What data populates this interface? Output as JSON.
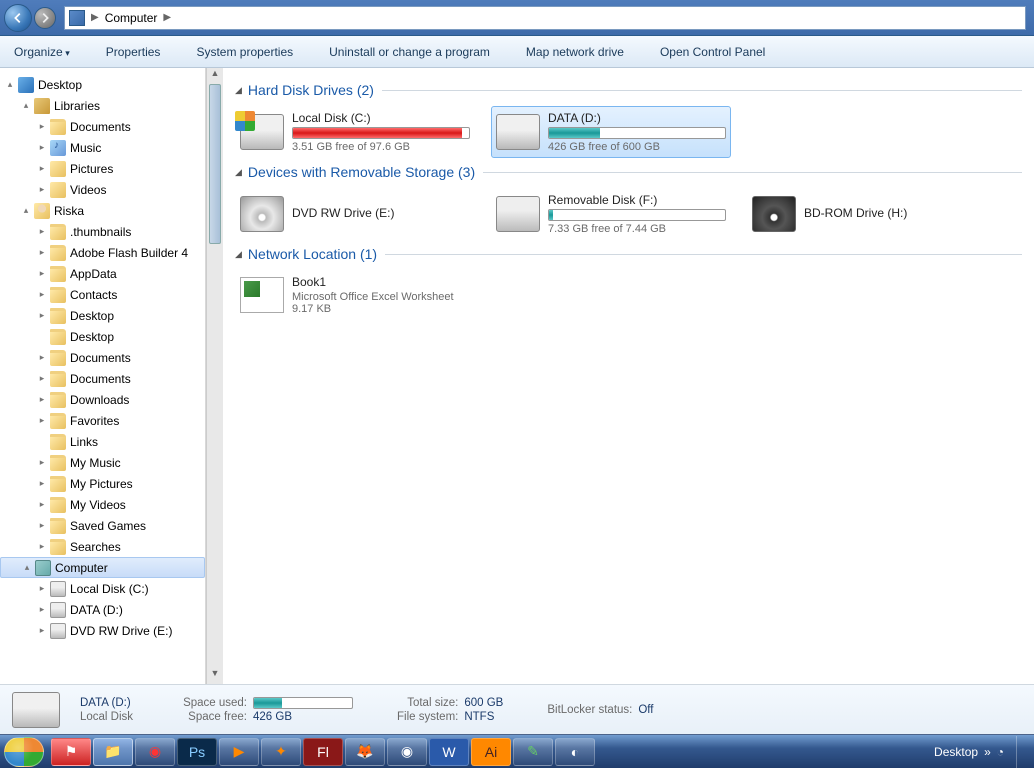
{
  "address": {
    "root": "Computer"
  },
  "toolbar": {
    "organize": "Organize",
    "properties": "Properties",
    "system_properties": "System properties",
    "uninstall": "Uninstall or change a program",
    "map_drive": "Map network drive",
    "control_panel": "Open Control Panel"
  },
  "tree": [
    {
      "d": 0,
      "exp": "▴",
      "icon": "i-desktop",
      "label": "Desktop"
    },
    {
      "d": 1,
      "exp": "▴",
      "icon": "i-lib",
      "label": "Libraries"
    },
    {
      "d": 2,
      "exp": "▸",
      "icon": "i-folder",
      "label": "Documents"
    },
    {
      "d": 2,
      "exp": "▸",
      "icon": "i-music",
      "label": "Music"
    },
    {
      "d": 2,
      "exp": "▸",
      "icon": "i-pic",
      "label": "Pictures"
    },
    {
      "d": 2,
      "exp": "▸",
      "icon": "i-vid",
      "label": "Videos"
    },
    {
      "d": 1,
      "exp": "▴",
      "icon": "i-user",
      "label": "Riska"
    },
    {
      "d": 2,
      "exp": "▸",
      "icon": "i-folder",
      "label": ".thumbnails"
    },
    {
      "d": 2,
      "exp": "▸",
      "icon": "i-folder",
      "label": "Adobe Flash Builder 4"
    },
    {
      "d": 2,
      "exp": "▸",
      "icon": "i-folder",
      "label": "AppData"
    },
    {
      "d": 2,
      "exp": "▸",
      "icon": "i-folder",
      "label": "Contacts"
    },
    {
      "d": 2,
      "exp": "▸",
      "icon": "i-folder",
      "label": "Desktop"
    },
    {
      "d": 2,
      "exp": "",
      "icon": "i-folder",
      "label": "Desktop"
    },
    {
      "d": 2,
      "exp": "▸",
      "icon": "i-folder",
      "label": "Documents"
    },
    {
      "d": 2,
      "exp": "▸",
      "icon": "i-folder",
      "label": "Documents"
    },
    {
      "d": 2,
      "exp": "▸",
      "icon": "i-folder",
      "label": "Downloads"
    },
    {
      "d": 2,
      "exp": "▸",
      "icon": "i-folder",
      "label": "Favorites"
    },
    {
      "d": 2,
      "exp": "",
      "icon": "i-folder",
      "label": "Links"
    },
    {
      "d": 2,
      "exp": "▸",
      "icon": "i-folder",
      "label": "My Music"
    },
    {
      "d": 2,
      "exp": "▸",
      "icon": "i-folder",
      "label": "My Pictures"
    },
    {
      "d": 2,
      "exp": "▸",
      "icon": "i-folder",
      "label": "My Videos"
    },
    {
      "d": 2,
      "exp": "▸",
      "icon": "i-folder",
      "label": "Saved Games"
    },
    {
      "d": 2,
      "exp": "▸",
      "icon": "i-folder",
      "label": "Searches"
    },
    {
      "d": 1,
      "exp": "▴",
      "icon": "i-comp",
      "label": "Computer",
      "selected": true
    },
    {
      "d": 2,
      "exp": "▸",
      "icon": "i-drive",
      "label": "Local Disk (C:)"
    },
    {
      "d": 2,
      "exp": "▸",
      "icon": "i-drive",
      "label": "DATA (D:)"
    },
    {
      "d": 2,
      "exp": "▸",
      "icon": "i-drive",
      "label": "DVD RW Drive (E:)"
    }
  ],
  "sections": {
    "hdd": {
      "title": "Hard Disk Drives (2)"
    },
    "removable": {
      "title": "Devices with Removable Storage (3)"
    },
    "network": {
      "title": "Network Location (1)"
    }
  },
  "drives": {
    "c": {
      "name": "Local Disk (C:)",
      "free": "3.51 GB free of 97.6 GB",
      "pct": 96,
      "bar": "fill-red"
    },
    "d": {
      "name": "DATA (D:)",
      "free": "426 GB free of 600 GB",
      "pct": 29,
      "bar": "fill-teal"
    },
    "dvd": {
      "name": "DVD RW Drive (E:)"
    },
    "f": {
      "name": "Removable Disk (F:)",
      "free": "7.33 GB free of 7.44 GB",
      "pct": 2,
      "bar": "fill-teal"
    },
    "bd": {
      "name": "BD-ROM Drive (H:)"
    },
    "book": {
      "name": "Book1",
      "type": "Microsoft Office Excel Worksheet",
      "size": "9.17 KB"
    }
  },
  "details": {
    "name": "DATA (D:)",
    "kind": "Local Disk",
    "space_used_label": "Space used:",
    "space_free_label": "Space free:",
    "space_free": "426 GB",
    "total_label": "Total size:",
    "total": "600 GB",
    "fs_label": "File system:",
    "fs": "NTFS",
    "bitlocker_label": "BitLocker status:",
    "bitlocker": "Off",
    "used_pct": 29
  },
  "taskbar": {
    "desktop_toolbar": "Desktop"
  }
}
